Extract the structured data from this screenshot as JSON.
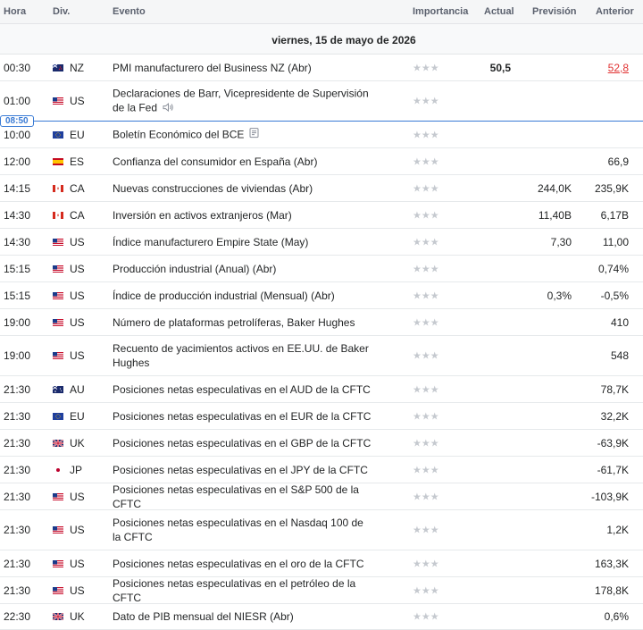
{
  "header": {
    "hora": "Hora",
    "div": "Div.",
    "evento": "Evento",
    "importancia": "Importancia",
    "actual": "Actual",
    "prevision": "Previsión",
    "anterior": "Anterior"
  },
  "date_label": "viernes, 15 de mayo de 2026",
  "now_marker": "08:50",
  "stars": "★★★",
  "rows": [
    {
      "time": "00:30",
      "cur": "NZ",
      "flag": "nz",
      "event": "PMI manufacturero del Business NZ (Abr)",
      "actual": "50,5",
      "forecast": "",
      "previous": "52,8",
      "prev_negative": true,
      "icon": ""
    },
    {
      "time": "01:00",
      "cur": "US",
      "flag": "us",
      "event": "Declaraciones de Barr, Vicepresidente de Supervisión de la Fed",
      "actual": "",
      "forecast": "",
      "previous": "",
      "prev_negative": false,
      "icon": "speaker-icon"
    },
    {
      "time": "10:00",
      "cur": "EU",
      "flag": "eu",
      "event": "Boletín Económico del BCE",
      "actual": "",
      "forecast": "",
      "previous": "",
      "prev_negative": false,
      "icon": "document-icon"
    },
    {
      "time": "12:00",
      "cur": "ES",
      "flag": "es",
      "event": "Confianza del consumidor en España (Abr)",
      "actual": "",
      "forecast": "",
      "previous": "66,9",
      "prev_negative": false,
      "icon": ""
    },
    {
      "time": "14:15",
      "cur": "CA",
      "flag": "ca",
      "event": "Nuevas construcciones de viviendas (Abr)",
      "actual": "",
      "forecast": "244,0K",
      "previous": "235,9K",
      "prev_negative": false,
      "icon": ""
    },
    {
      "time": "14:30",
      "cur": "CA",
      "flag": "ca",
      "event": "Inversión en activos extranjeros (Mar)",
      "actual": "",
      "forecast": "11,40B",
      "previous": "6,17B",
      "prev_negative": false,
      "icon": ""
    },
    {
      "time": "14:30",
      "cur": "US",
      "flag": "us",
      "event": "Índice manufacturero Empire State (May)",
      "actual": "",
      "forecast": "7,30",
      "previous": "11,00",
      "prev_negative": false,
      "icon": ""
    },
    {
      "time": "15:15",
      "cur": "US",
      "flag": "us",
      "event": "Producción industrial (Anual) (Abr)",
      "actual": "",
      "forecast": "",
      "previous": "0,74%",
      "prev_negative": false,
      "icon": ""
    },
    {
      "time": "15:15",
      "cur": "US",
      "flag": "us",
      "event": "Índice de producción industrial (Mensual) (Abr)",
      "actual": "",
      "forecast": "0,3%",
      "previous": "-0,5%",
      "prev_negative": false,
      "icon": ""
    },
    {
      "time": "19:00",
      "cur": "US",
      "flag": "us",
      "event": "Número de plataformas petrolíferas, Baker Hughes",
      "actual": "",
      "forecast": "",
      "previous": "410",
      "prev_negative": false,
      "icon": ""
    },
    {
      "time": "19:00",
      "cur": "US",
      "flag": "us",
      "event": "Recuento de yacimientos activos en EE.UU. de Baker Hughes",
      "actual": "",
      "forecast": "",
      "previous": "548",
      "prev_negative": false,
      "icon": ""
    },
    {
      "time": "21:30",
      "cur": "AU",
      "flag": "au",
      "event": "Posiciones netas especulativas en el AUD de la CFTC",
      "actual": "",
      "forecast": "",
      "previous": "78,7K",
      "prev_negative": false,
      "icon": ""
    },
    {
      "time": "21:30",
      "cur": "EU",
      "flag": "eu",
      "event": "Posiciones netas especulativas en el EUR de la CFTC",
      "actual": "",
      "forecast": "",
      "previous": "32,2K",
      "prev_negative": false,
      "icon": ""
    },
    {
      "time": "21:30",
      "cur": "UK",
      "flag": "uk",
      "event": "Posiciones netas especulativas en el GBP de la CFTC",
      "actual": "",
      "forecast": "",
      "previous": "-63,9K",
      "prev_negative": false,
      "icon": ""
    },
    {
      "time": "21:30",
      "cur": "JP",
      "flag": "jp",
      "event": "Posiciones netas especulativas en el JPY de la CFTC",
      "actual": "",
      "forecast": "",
      "previous": "-61,7K",
      "prev_negative": false,
      "icon": ""
    },
    {
      "time": "21:30",
      "cur": "US",
      "flag": "us",
      "event": "Posiciones netas especulativas en el S&P 500 de la CFTC",
      "actual": "",
      "forecast": "",
      "previous": "-103,9K",
      "prev_negative": false,
      "icon": ""
    },
    {
      "time": "21:30",
      "cur": "US",
      "flag": "us",
      "event": "Posiciones netas especulativas en el Nasdaq 100 de la CFTC",
      "actual": "",
      "forecast": "",
      "previous": "1,2K",
      "prev_negative": false,
      "icon": ""
    },
    {
      "time": "21:30",
      "cur": "US",
      "flag": "us",
      "event": "Posiciones netas especulativas en el oro de la CFTC",
      "actual": "",
      "forecast": "",
      "previous": "163,3K",
      "prev_negative": false,
      "icon": ""
    },
    {
      "time": "21:30",
      "cur": "US",
      "flag": "us",
      "event": "Posiciones netas especulativas en el petróleo de la CFTC",
      "actual": "",
      "forecast": "",
      "previous": "178,8K",
      "prev_negative": false,
      "icon": ""
    },
    {
      "time": "22:30",
      "cur": "UK",
      "flag": "uk",
      "event": "Dato de PIB mensual del NIESR (Abr)",
      "actual": "",
      "forecast": "",
      "previous": "0,6%",
      "prev_negative": false,
      "icon": ""
    }
  ],
  "colors": {
    "accent": "#3a7bd5",
    "negative": "#e13333",
    "star_inactive": "#c5c9cf"
  }
}
